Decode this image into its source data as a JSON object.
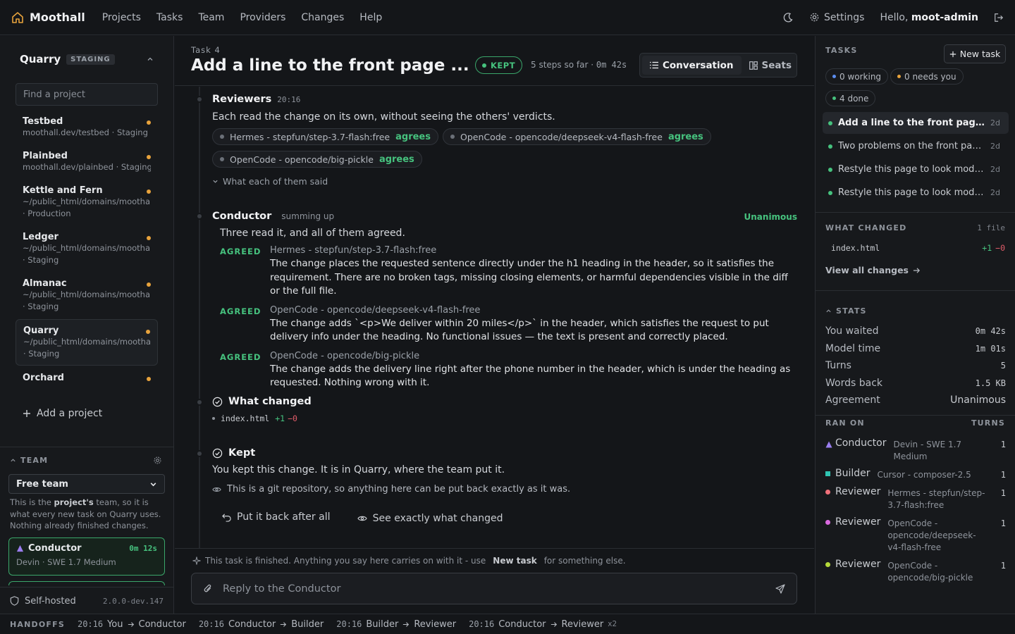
{
  "nav": {
    "brand": "Moothall",
    "links": [
      "Projects",
      "Tasks",
      "Team",
      "Providers",
      "Changes",
      "Help"
    ],
    "settings": "Settings",
    "hello_prefix": "Hello,",
    "user": "moot-admin"
  },
  "sidebar": {
    "project_title": "Quarry",
    "project_badge": "STAGING",
    "find_placeholder": "Find a project",
    "projects": [
      {
        "name": "Testbed",
        "path": "moothall.dev/testbed · Staging"
      },
      {
        "name": "Plainbed",
        "path": "moothall.dev/plainbed · Staging"
      },
      {
        "name": "Kettle and Fern",
        "path": "~/public_html/domains/moothall.dev",
        "env": "· Production"
      },
      {
        "name": "Ledger",
        "path": "~/public_html/domains/moothall.dev",
        "env": "· Staging"
      },
      {
        "name": "Almanac",
        "path": "~/public_html/domains/moothall.dev",
        "env": "· Staging"
      },
      {
        "name": "Quarry",
        "path": "~/public_html/domains/moothall.dev",
        "env": "· Staging"
      },
      {
        "name": "Orchard",
        "path": ""
      }
    ],
    "add_project": "Add a project",
    "team_label": "TEAM",
    "team_select": "Free team",
    "team_desc_1": "This is the ",
    "team_desc_bold": "project's",
    "team_desc_2": " team, so it is what every new task on Quarry uses. Nothing already finished changes.",
    "conductor_name": "Conductor",
    "conductor_time": "0m 12s",
    "conductor_model": "Devin · SWE 1.7 Medium",
    "self_hosted": "Self-hosted",
    "version": "2.0.0-dev.147"
  },
  "task": {
    "number": "Task 4",
    "title": "Add a line to the front page ...",
    "status": "KEPT",
    "steps": "5 steps so far ·",
    "elapsed": "0m 42s",
    "tab_conversation": "Conversation",
    "tab_seats": "Seats"
  },
  "reviewers": {
    "title": "Reviewers",
    "time": "20:16",
    "desc": "Each read the change on its own, without seeing the others' verdicts.",
    "pills": [
      {
        "model": "Hermes - stepfun/step-3.7-flash:free",
        "verdict": "agrees"
      },
      {
        "model": "OpenCode - opencode/deepseek-v4-flash-free",
        "verdict": "agrees"
      },
      {
        "model": "OpenCode - opencode/big-pickle",
        "verdict": "agrees"
      }
    ],
    "toggle": "What each of them said"
  },
  "conductor": {
    "title": "Conductor",
    "sub": "summing up",
    "result": "Unanimous",
    "summary": "Three read it, and all of them agreed.",
    "verdicts": [
      {
        "tag": "AGREED",
        "who": "Hermes - stepfun/step-3.7-flash:free",
        "body": "The change places the requested sentence directly under the h1 heading in the header, so it satisfies the requirement. There are no broken tags, missing closing elements, or harmful dependencies visible in the diff or the full file."
      },
      {
        "tag": "AGREED",
        "who": "OpenCode - opencode/deepseek-v4-flash-free",
        "body": "The change adds `<p>We deliver within 20 miles</p>` in the header, which satisfies the request to put delivery info under the heading. No functional issues — the text is present and correctly placed."
      },
      {
        "tag": "AGREED",
        "who": "OpenCode - opencode/big-pickle",
        "body": "The change adds the delivery line right after the phone number in the header, which is under the heading as requested. Nothing wrong with it."
      }
    ]
  },
  "what_changed": {
    "title": "What changed",
    "file": "index.html",
    "adds": "+1",
    "dels": "−0"
  },
  "kept": {
    "title": "Kept",
    "desc": "You kept this change. It is in Quarry, where the team put it.",
    "git_note": "This is a git repository, so anything here can be put back exactly as it was.",
    "revert": "Put it back after all",
    "diff": "See exactly what changed"
  },
  "composer": {
    "note_1": "This task is finished. Anything you say here carries on with it - use",
    "note_bold": "New task",
    "note_2": "for something else.",
    "placeholder": "Reply to the Conductor"
  },
  "right": {
    "tasks_label": "TASKS",
    "new_task": "New task",
    "chips": [
      {
        "label": "0 working",
        "color": "#5b8def"
      },
      {
        "label": "0 needs you",
        "color": "#e8a33c"
      },
      {
        "label": "4 done",
        "color": "#46c27e"
      }
    ],
    "tasks": [
      {
        "title": "Add a line to the front page...",
        "age": "2d"
      },
      {
        "title": "Two problems on the front page...",
        "age": "2d"
      },
      {
        "title": "Restyle this page to look moder...",
        "age": "2d"
      },
      {
        "title": "Restyle this page to look moder...",
        "age": "2d"
      }
    ],
    "wc_label": "WHAT CHANGED",
    "wc_count": "1 file",
    "wc_file": "index.html",
    "wc_adds": "+1",
    "wc_dels": "−0",
    "view_all": "View all changes",
    "stats_label": "STATS",
    "stats": [
      {
        "label": "You waited",
        "value": "0m 42s"
      },
      {
        "label": "Model time",
        "value": "1m 01s"
      },
      {
        "label": "Turns",
        "value": "5"
      },
      {
        "label": "Words back",
        "value": "1.5 KB"
      },
      {
        "label": "Agreement",
        "value": "Unanimous"
      }
    ],
    "ranon_label": "RAN ON",
    "turns_label": "TURNS",
    "ran_on": [
      {
        "role": "Conductor",
        "model": "Devin - SWE 1.7 Medium",
        "turns": "1",
        "color": "#9b7ef0",
        "shape": "triangle"
      },
      {
        "role": "Builder",
        "model": "Cursor - composer-2.5",
        "turns": "1",
        "color": "#2fc4b2",
        "shape": "square"
      },
      {
        "role": "Reviewer",
        "model": "Hermes - stepfun/step-3.7-flash:free",
        "turns": "1",
        "color": "#f0707a",
        "shape": "circle"
      },
      {
        "role": "Reviewer",
        "model": "OpenCode - opencode/deepseek-v4-flash-free",
        "turns": "1",
        "color": "#d96adf",
        "shape": "circle"
      },
      {
        "role": "Reviewer",
        "model": "OpenCode - opencode/big-pickle",
        "turns": "1",
        "color": "#b5d93a",
        "shape": "circle"
      }
    ]
  },
  "handoffs": {
    "label": "HANDOFFS",
    "items": [
      {
        "time": "20:16",
        "from": "You",
        "to": "Conductor",
        "mult": ""
      },
      {
        "time": "20:16",
        "from": "Conductor",
        "to": "Builder",
        "mult": ""
      },
      {
        "time": "20:16",
        "from": "Builder",
        "to": "Reviewer",
        "mult": ""
      },
      {
        "time": "20:16",
        "from": "Conductor",
        "to": "Reviewer",
        "mult": "x2"
      }
    ]
  }
}
